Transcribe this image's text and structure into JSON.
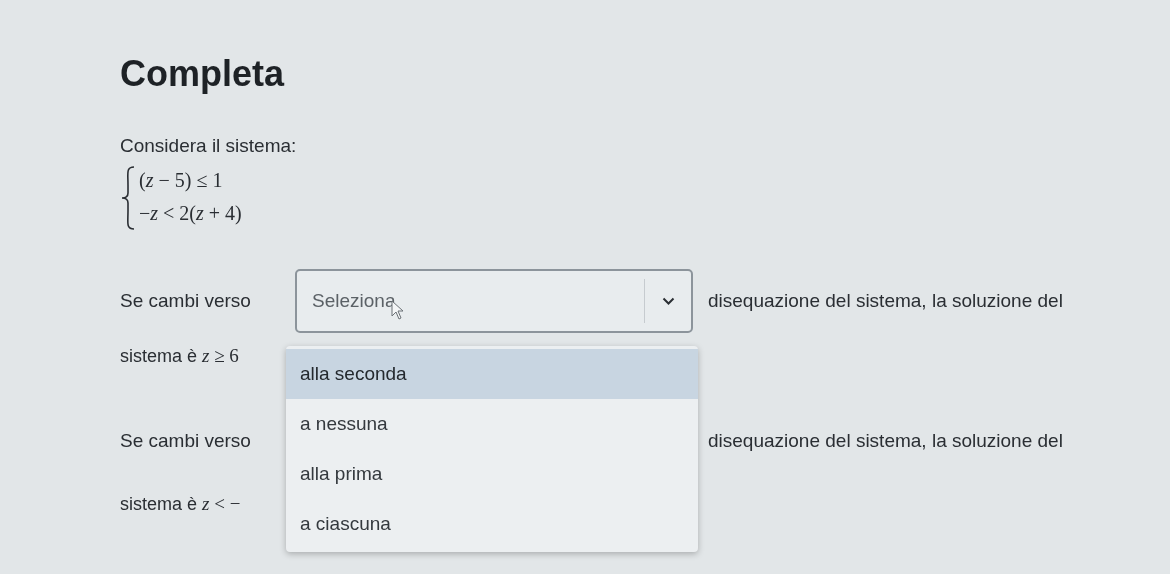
{
  "title": "Completa",
  "prompt": "Considera il sistema:",
  "system": [
    "(*z* − 5) ≤ 1",
    "−*z* < 2(*z* + 4)"
  ],
  "questions": [
    {
      "before": "Se cambi verso",
      "select": {
        "placeholder": "Seleziona",
        "expanded": true,
        "options": [
          {
            "label": "alla seconda",
            "selected": true
          },
          {
            "label": "a nessuna",
            "selected": false
          },
          {
            "label": "alla prima",
            "selected": false
          },
          {
            "label": "a ciascuna",
            "selected": false
          }
        ]
      },
      "after": "disequazione del sistema, la soluzione del",
      "continuation": "sistema è",
      "math": "*z* ≥ 6"
    },
    {
      "before": "Se cambi verso",
      "after": "disequazione del sistema, la soluzione del",
      "continuation": "sistema è",
      "math": "*z* < −"
    }
  ]
}
